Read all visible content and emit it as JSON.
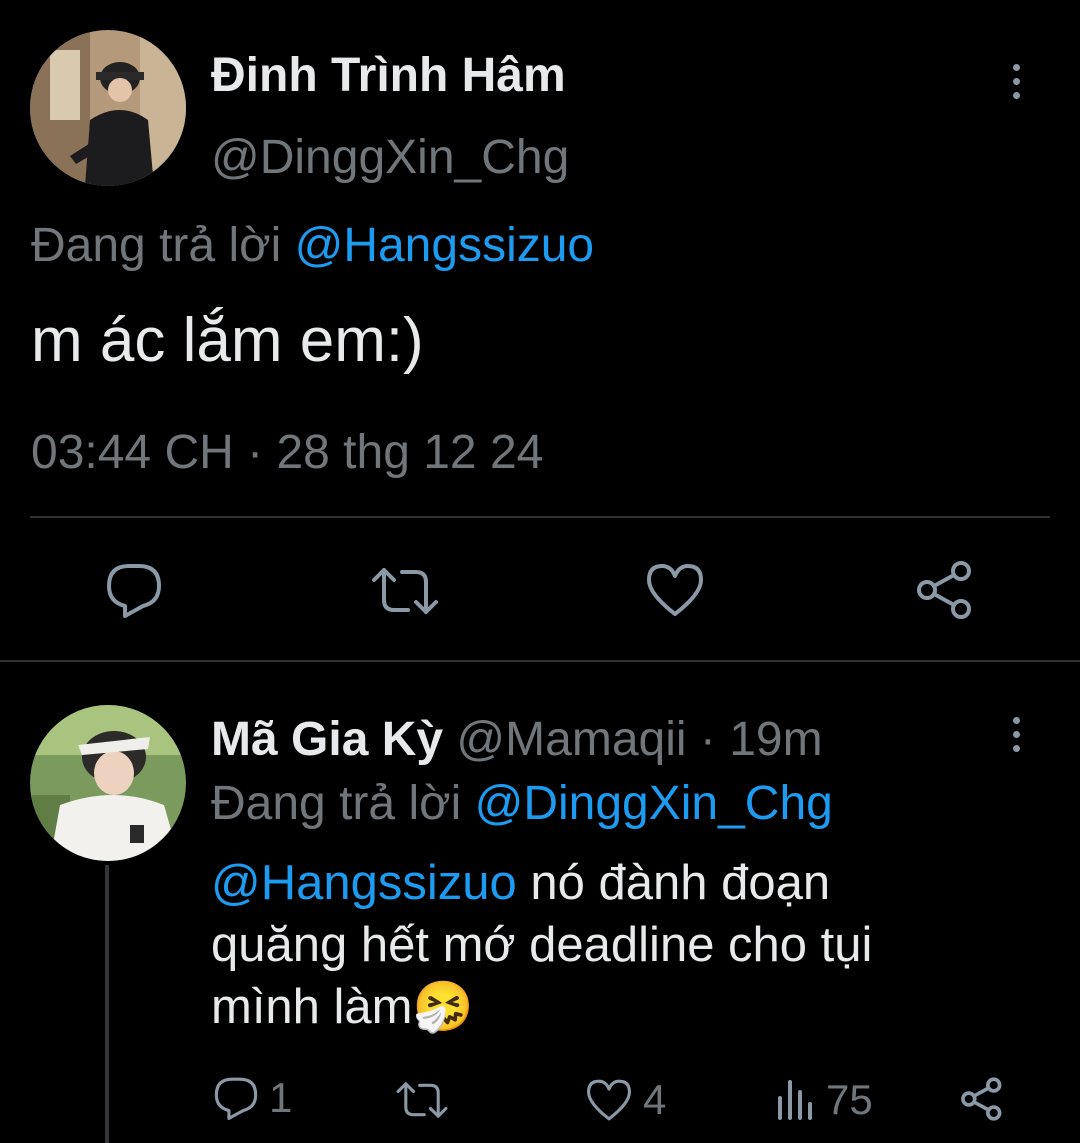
{
  "main_tweet": {
    "display_name": "Đinh Trình Hâm",
    "handle": "@DinggXin_Chg",
    "reply_prefix": "Đang trả lời",
    "reply_to": "@Hangssizuo",
    "text": "m ác lắm em:)",
    "timestamp": "03:44 CH · 28 thg 12 24",
    "actions": [
      "reply-icon",
      "retweet-icon",
      "like-icon",
      "share-icon"
    ]
  },
  "reply_tweet": {
    "display_name": "Mã Gia Kỳ",
    "handle": "@Mamaqii",
    "time": "· 19m",
    "reply_prefix": "Đang trả lời",
    "reply_to": "@DinggXin_Chg",
    "mention": "@Hangssizuo",
    "text_line1": " nó đành đoạn",
    "text_line2": "quăng hết mớ deadline cho tụi",
    "text_line3": "mình làm",
    "emoji": "🤧",
    "reply_count": "1",
    "like_count": "4",
    "view_count": "75"
  },
  "colors": {
    "background": "#000000",
    "text": "#e7e9ea",
    "muted": "#71767b",
    "link": "#1d9bf0",
    "divider": "#2f3336"
  }
}
